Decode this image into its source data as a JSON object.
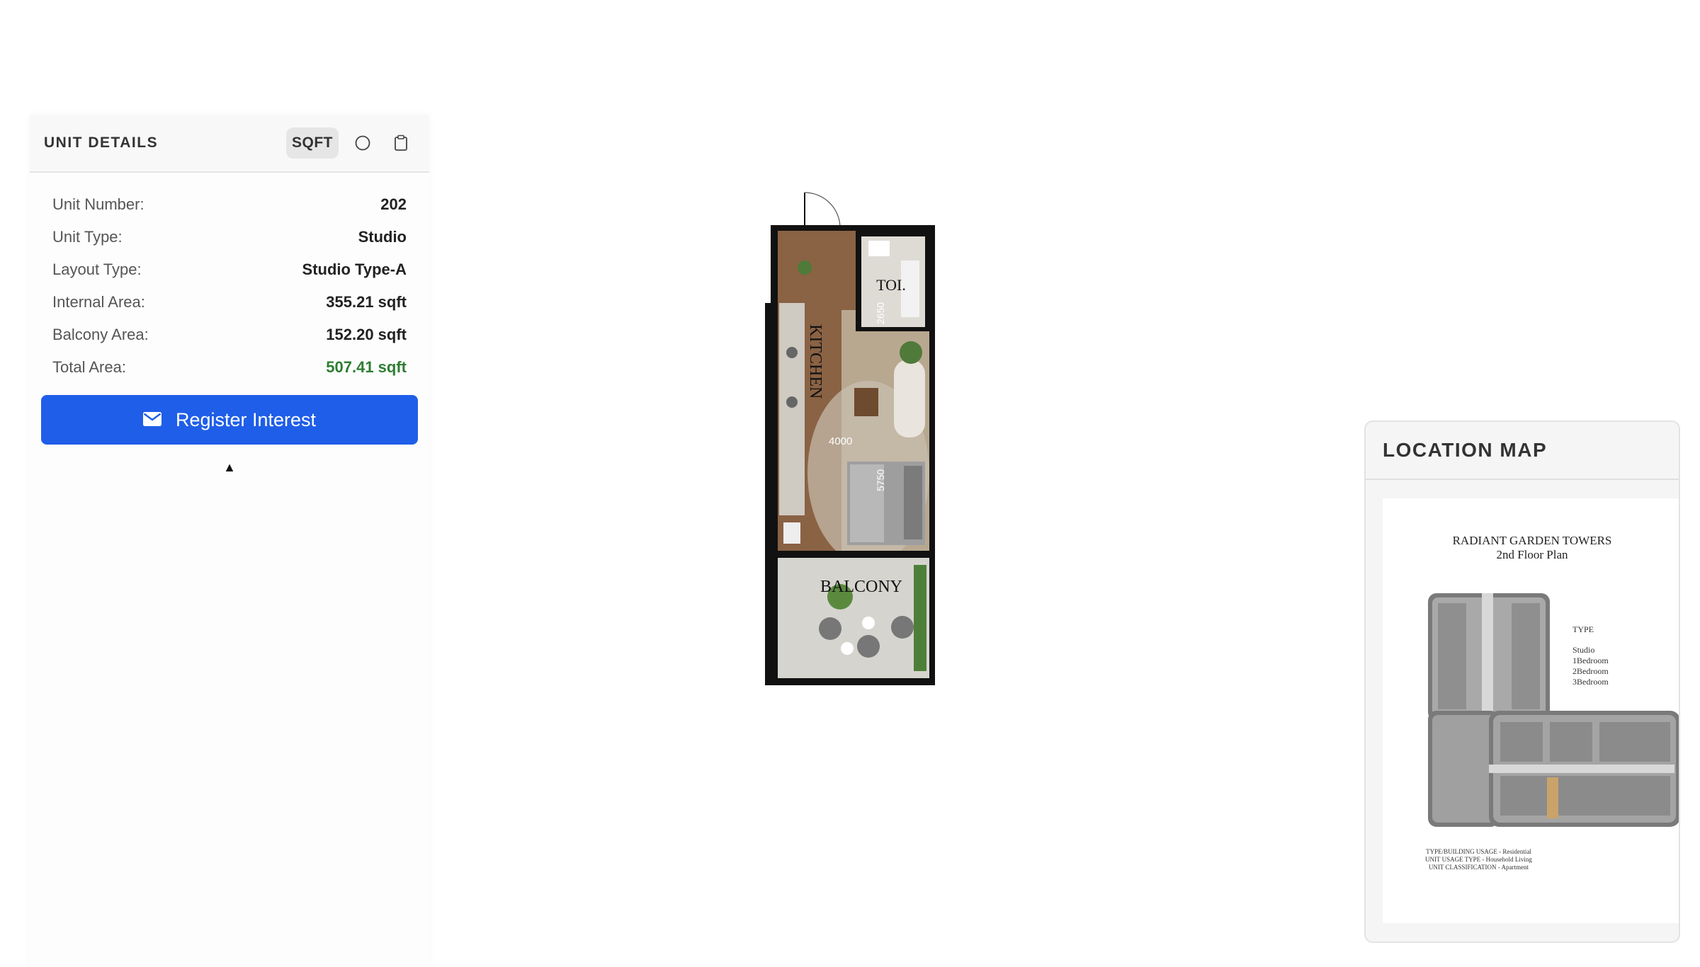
{
  "unit_details": {
    "title": "UNIT DETAILS",
    "unit_toggle_label": "SQFT",
    "rows": [
      {
        "label": "Unit Number:",
        "value": "202"
      },
      {
        "label": "Unit Type:",
        "value": "Studio"
      },
      {
        "label": "Layout Type:",
        "value": "Studio Type-A"
      },
      {
        "label": "Internal Area:",
        "value": "355.21 sqft"
      },
      {
        "label": "Balcony Area:",
        "value": "152.20 sqft"
      },
      {
        "label": "Total Area:",
        "value": "507.41 sqft"
      }
    ],
    "register_button_label": "Register Interest",
    "collapse_glyph": "▲",
    "icons": [
      "circle-icon",
      "clipboard-icon",
      "envelope-icon"
    ]
  },
  "floor_plan": {
    "room_labels": {
      "toilet": "TOI.",
      "kitchen": "KITCHEN",
      "balcony": "BALCONY"
    },
    "dimensions": {
      "toilet_depth": "2650",
      "width": "4000",
      "living_depth": "5750"
    }
  },
  "location_map": {
    "title": "LOCATION MAP",
    "building_name": "RADIANT GARDEN TOWERS",
    "floor_label": "2nd Floor Plan",
    "legend_title": "TYPE",
    "legend_items": [
      "Studio",
      "1Bedroom",
      "2Bedroom",
      "3Bedroom"
    ],
    "notes": [
      "TYPE/BUILDING USAGE - Residential",
      "UNIT USAGE TYPE - Household Living",
      "UNIT CLASSIFICATION - Apartment"
    ]
  },
  "colors": {
    "primary": "#1f5ee8",
    "total_area": "#2e7d32",
    "panel_bg": "#f8f8f8"
  }
}
